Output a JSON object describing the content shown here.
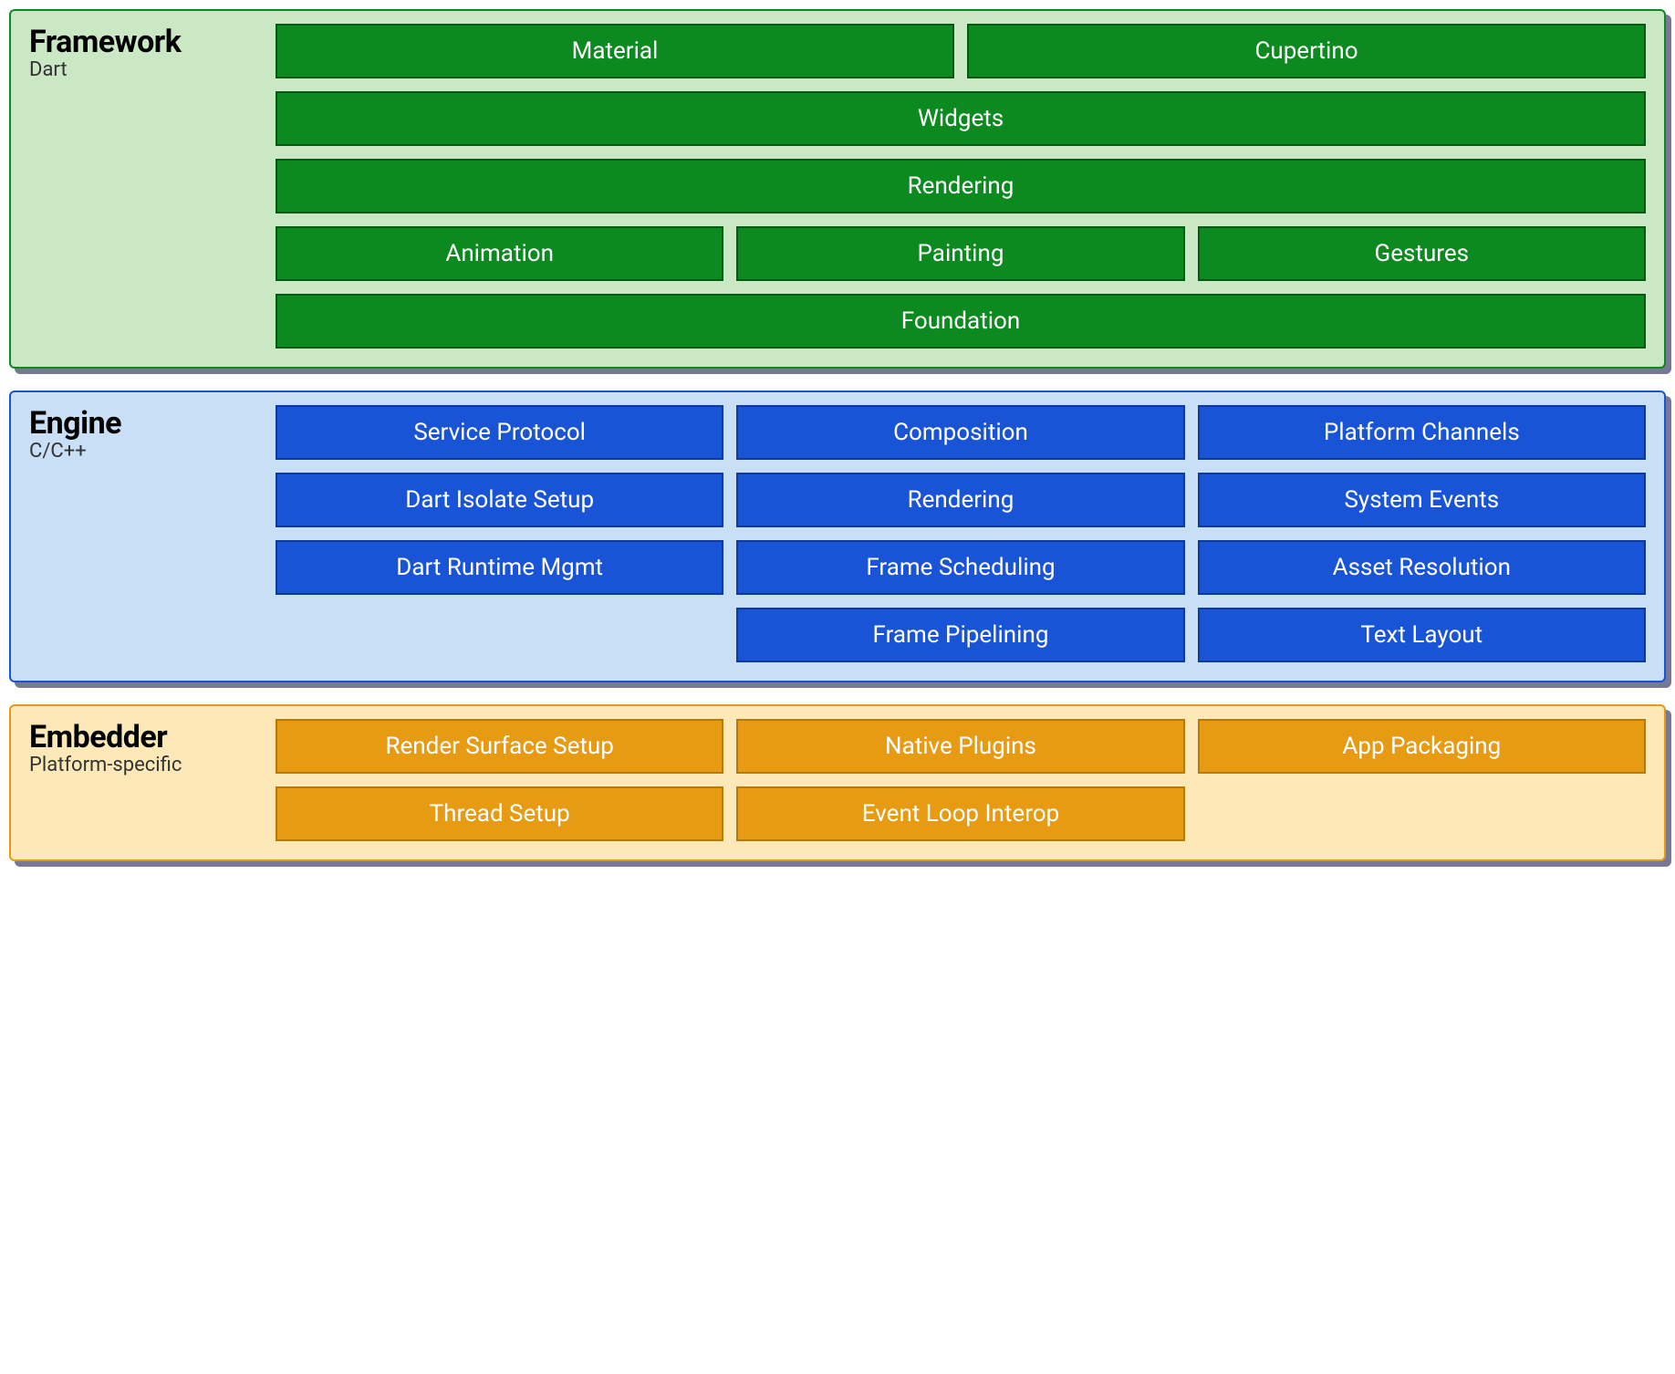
{
  "framework": {
    "title": "Framework",
    "subtitle": "Dart",
    "rows": {
      "r1": {
        "material": "Material",
        "cupertino": "Cupertino"
      },
      "r2": {
        "widgets": "Widgets"
      },
      "r3": {
        "rendering": "Rendering"
      },
      "r4": {
        "animation": "Animation",
        "painting": "Painting",
        "gestures": "Gestures"
      },
      "r5": {
        "foundation": "Foundation"
      }
    }
  },
  "engine": {
    "title": "Engine",
    "subtitle": "C/C++",
    "rows": {
      "r1": {
        "service_protocol": "Service Protocol",
        "composition": "Composition",
        "platform_channels": "Platform Channels"
      },
      "r2": {
        "dart_isolate_setup": "Dart Isolate Setup",
        "rendering": "Rendering",
        "system_events": "System Events"
      },
      "r3": {
        "dart_runtime_mgmt": "Dart Runtime Mgmt",
        "frame_scheduling": "Frame Scheduling",
        "asset_resolution": "Asset Resolution"
      },
      "r4": {
        "frame_pipelining": "Frame Pipelining",
        "text_layout": "Text Layout"
      }
    }
  },
  "embedder": {
    "title": "Embedder",
    "subtitle": "Platform-specific",
    "rows": {
      "r1": {
        "render_surface_setup": "Render Surface Setup",
        "native_plugins": "Native Plugins",
        "app_packaging": "App Packaging"
      },
      "r2": {
        "thread_setup": "Thread Setup",
        "event_loop_interop": "Event Loop Interop"
      }
    }
  }
}
